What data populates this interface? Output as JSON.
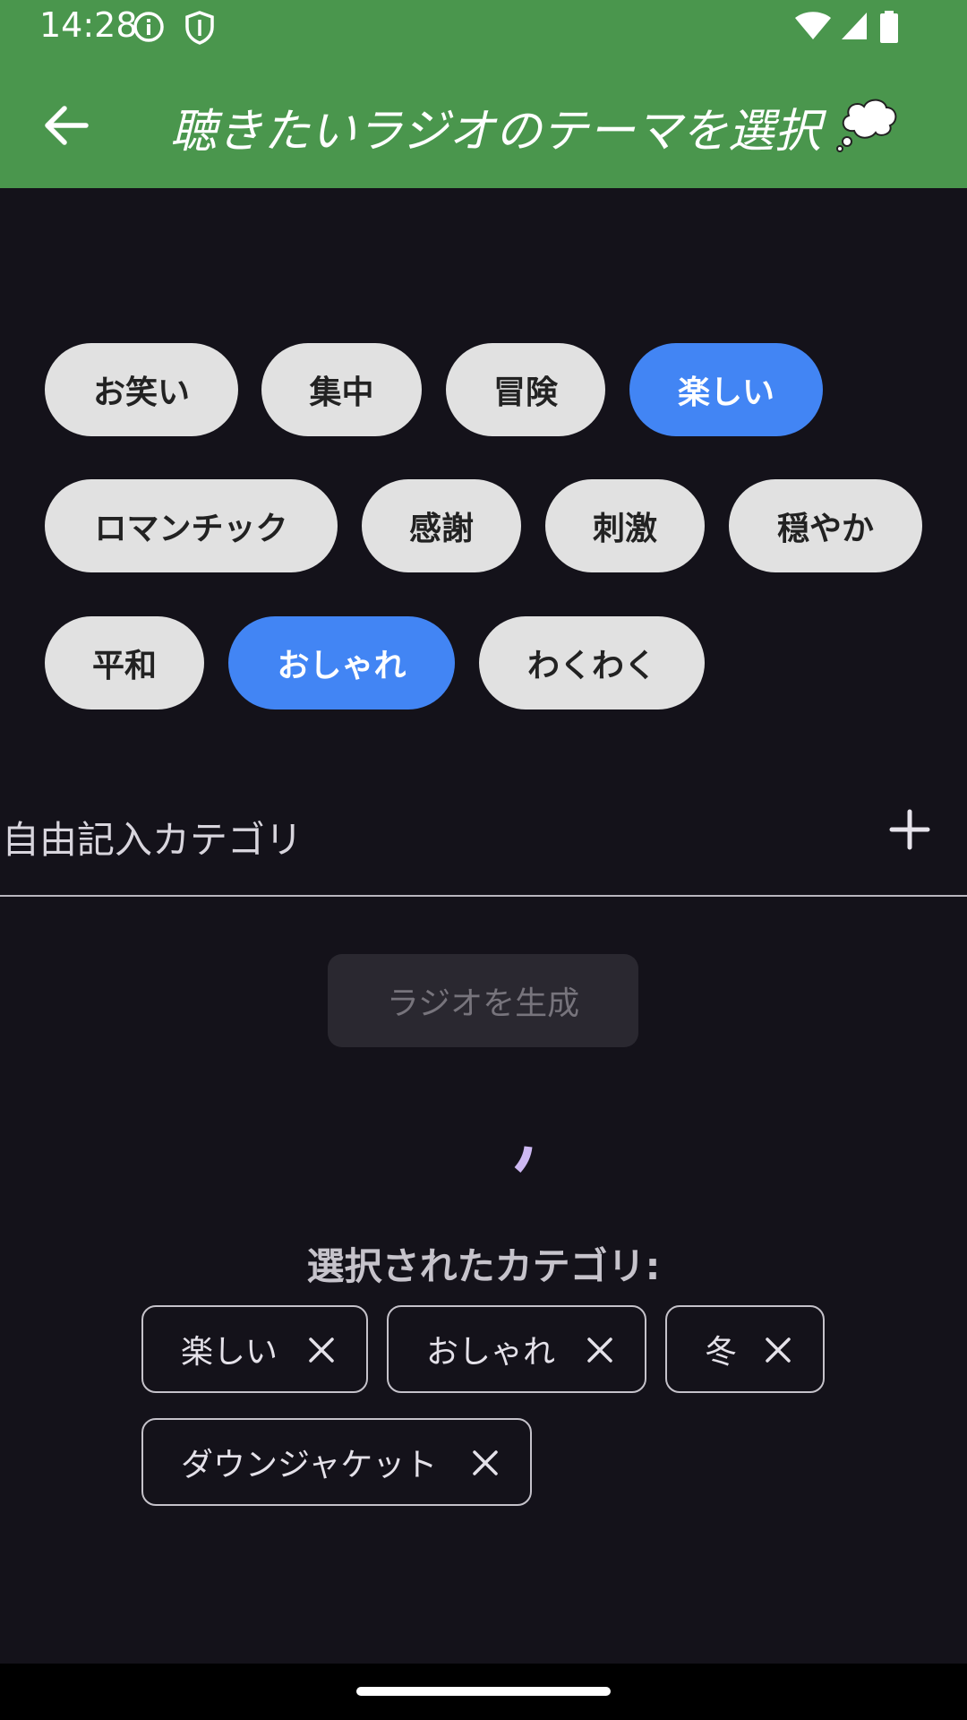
{
  "status_bar": {
    "time": "14:28",
    "icons": [
      "info-icon",
      "shield-icon",
      "wifi-icon",
      "signal-icon",
      "battery-icon"
    ]
  },
  "app_bar": {
    "back_icon": "arrow-back-icon",
    "title": "聴きたいラジオのテーマを選択",
    "title_icon": "thought-bubble-icon"
  },
  "categories": [
    {
      "label": "お笑い",
      "selected": false
    },
    {
      "label": "集中",
      "selected": false
    },
    {
      "label": "冒険",
      "selected": false
    },
    {
      "label": "楽しい",
      "selected": true
    },
    {
      "label": "ロマンチック",
      "selected": false
    },
    {
      "label": "感謝",
      "selected": false
    },
    {
      "label": "刺激",
      "selected": false
    },
    {
      "label": "穏やか",
      "selected": false
    },
    {
      "label": "平和",
      "selected": false
    },
    {
      "label": "おしゃれ",
      "selected": true
    },
    {
      "label": "わくわく",
      "selected": false
    }
  ],
  "free_input": {
    "label": "自由記入カテゴリ",
    "add_icon": "plus-icon"
  },
  "generate_button": {
    "label": "ラジオを生成",
    "enabled": false
  },
  "loading": true,
  "selected_section": {
    "title": "選択されたカテゴリ:",
    "tags": [
      "楽しい",
      "おしゃれ",
      "冬",
      "ダウンジャケット"
    ],
    "remove_icon": "close-icon"
  },
  "colors": {
    "app_bar": "#4a964d",
    "background": "#14121a",
    "chip": "#e1e1e1",
    "chip_selected": "#4285f4",
    "spinner": "#cdb8f2"
  }
}
